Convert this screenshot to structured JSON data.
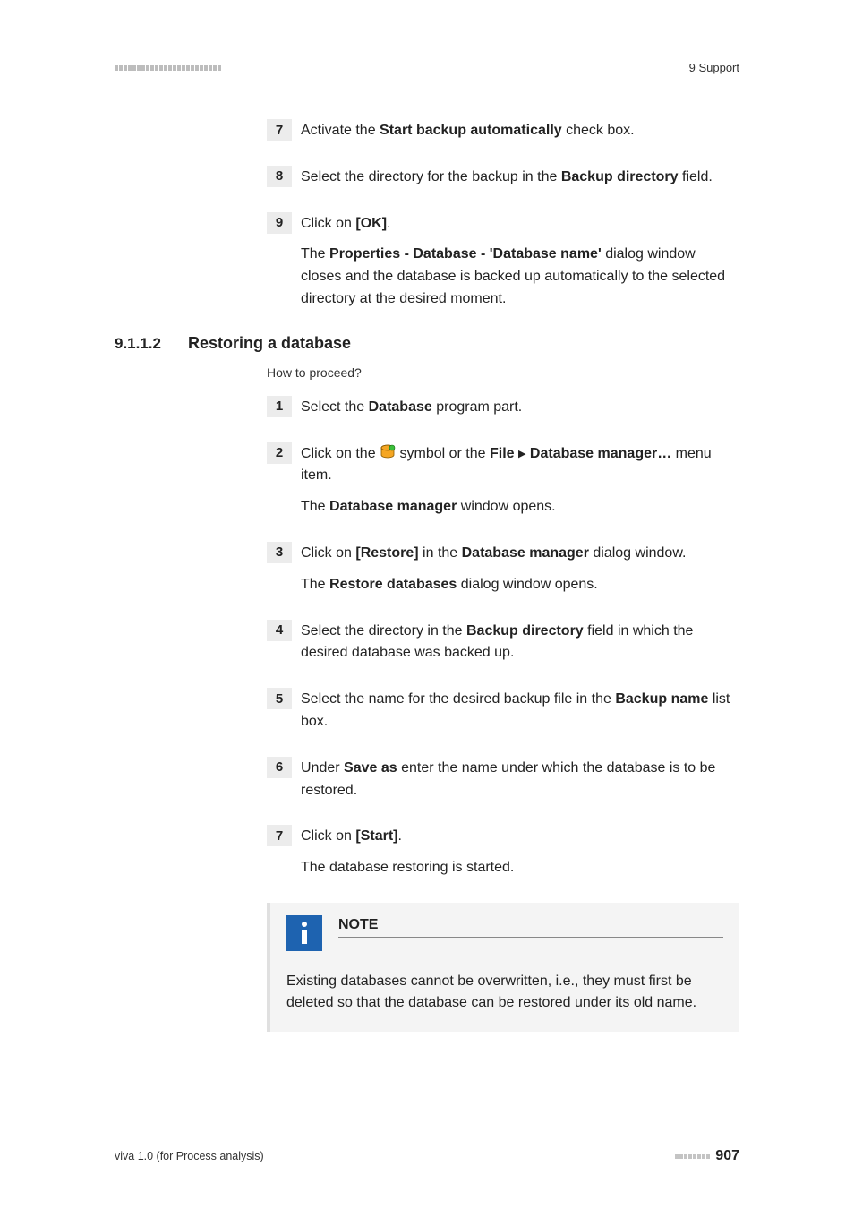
{
  "header": {
    "section_label": "9 Support"
  },
  "steps_a": [
    {
      "num": "7",
      "parts": [
        {
          "t": "Activate the "
        },
        {
          "t": "Start backup automatically",
          "b": true
        },
        {
          "t": " check box."
        }
      ]
    },
    {
      "num": "8",
      "parts": [
        {
          "t": "Select the directory for the backup in the "
        },
        {
          "t": "Backup directory",
          "b": true
        },
        {
          "t": " field."
        }
      ]
    },
    {
      "num": "9",
      "parts": [
        {
          "t": "Click on "
        },
        {
          "t": "[OK]",
          "b": true
        },
        {
          "t": "."
        }
      ],
      "extra": [
        {
          "t": "The "
        },
        {
          "t": "Properties - Database - 'Database name'",
          "b": true
        },
        {
          "t": " dialog window closes and the database is backed up automatically to the selected directory at the desired moment."
        }
      ]
    }
  ],
  "section": {
    "num": "9.1.1.2",
    "title": "Restoring a database",
    "howto": "How to proceed?"
  },
  "steps_b": [
    {
      "num": "1",
      "parts": [
        {
          "t": "Select the "
        },
        {
          "t": "Database",
          "b": true
        },
        {
          "t": " program part."
        }
      ]
    },
    {
      "num": "2",
      "icon": true,
      "pre": "Click on the ",
      "post_parts": [
        {
          "t": " symbol or the "
        },
        {
          "t": "File",
          "b": true
        },
        {
          "t": " "
        },
        {
          "tri": true
        },
        {
          "t": " "
        },
        {
          "t": "Database manager…",
          "b": true
        },
        {
          "t": " menu item."
        }
      ],
      "extra": [
        {
          "t": "The "
        },
        {
          "t": "Database manager",
          "b": true
        },
        {
          "t": " window opens."
        }
      ]
    },
    {
      "num": "3",
      "parts": [
        {
          "t": "Click on "
        },
        {
          "t": "[Restore]",
          "b": true
        },
        {
          "t": " in the "
        },
        {
          "t": "Database manager",
          "b": true
        },
        {
          "t": " dialog window."
        }
      ],
      "extra": [
        {
          "t": "The "
        },
        {
          "t": "Restore databases",
          "b": true
        },
        {
          "t": " dialog window opens."
        }
      ]
    },
    {
      "num": "4",
      "parts": [
        {
          "t": "Select the directory in the "
        },
        {
          "t": "Backup directory",
          "b": true
        },
        {
          "t": " field in which the desired database was backed up."
        }
      ]
    },
    {
      "num": "5",
      "parts": [
        {
          "t": "Select the name for the desired backup file in the "
        },
        {
          "t": "Backup name",
          "b": true
        },
        {
          "t": " list box."
        }
      ]
    },
    {
      "num": "6",
      "parts": [
        {
          "t": "Under "
        },
        {
          "t": "Save as",
          "b": true
        },
        {
          "t": " enter the name under which the database is to be restored."
        }
      ]
    },
    {
      "num": "7",
      "parts": [
        {
          "t": "Click on "
        },
        {
          "t": "[Start]",
          "b": true
        },
        {
          "t": "."
        }
      ],
      "extra": [
        {
          "t": "The database restoring is started."
        }
      ]
    }
  ],
  "note": {
    "title": "NOTE",
    "body": "Existing databases cannot be overwritten, i.e., they must first be deleted so that the database can be restored under its old name."
  },
  "footer": {
    "left": "viva 1.0 (for Process analysis)",
    "page": "907"
  }
}
